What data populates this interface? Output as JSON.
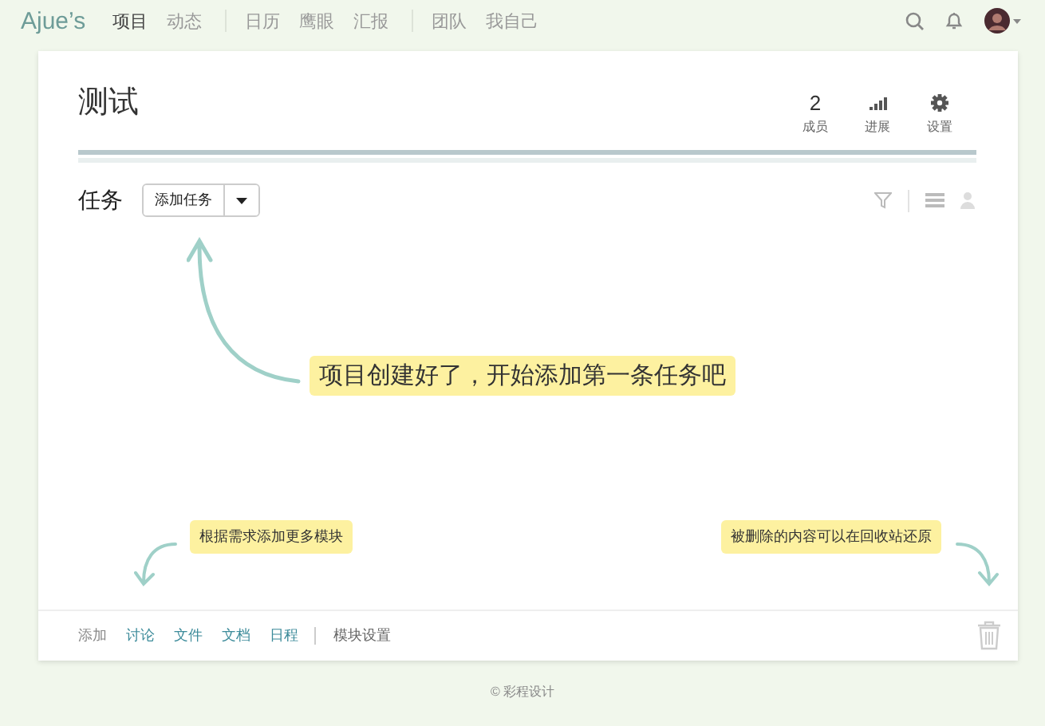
{
  "nav": {
    "logo": "Ajue’s",
    "groups": [
      [
        {
          "label": "项目",
          "selected": true
        },
        {
          "label": "动态",
          "selected": false
        }
      ],
      [
        {
          "label": "日历",
          "selected": false
        },
        {
          "label": "鹰眼",
          "selected": false
        },
        {
          "label": "汇报",
          "selected": false
        }
      ],
      [
        {
          "label": "团队",
          "selected": false
        },
        {
          "label": "我自己",
          "selected": false
        }
      ]
    ]
  },
  "project": {
    "title": "测试",
    "stats": [
      {
        "kind": "count",
        "value": "2",
        "label": "成员"
      },
      {
        "kind": "progress",
        "label": "进展"
      },
      {
        "kind": "settings",
        "label": "设置"
      }
    ]
  },
  "tasks": {
    "title": "任务",
    "add_button": "添加任务"
  },
  "hints": [
    {
      "kind": "main",
      "text": "项目创建好了，开始添加第一条任务吧"
    },
    {
      "kind": "left",
      "text": "根据需求添加更多模块"
    },
    {
      "kind": "right",
      "text": "被删除的内容可以在回收站还原"
    }
  ],
  "modules": [
    {
      "kind": "label",
      "text": "添加"
    },
    {
      "kind": "link",
      "text": "讨论"
    },
    {
      "kind": "link",
      "text": "文件"
    },
    {
      "kind": "link",
      "text": "文档"
    },
    {
      "kind": "link",
      "text": "日程"
    },
    {
      "kind": "setting",
      "text": "模块设置"
    }
  ],
  "footer": "© 彩程设计"
}
